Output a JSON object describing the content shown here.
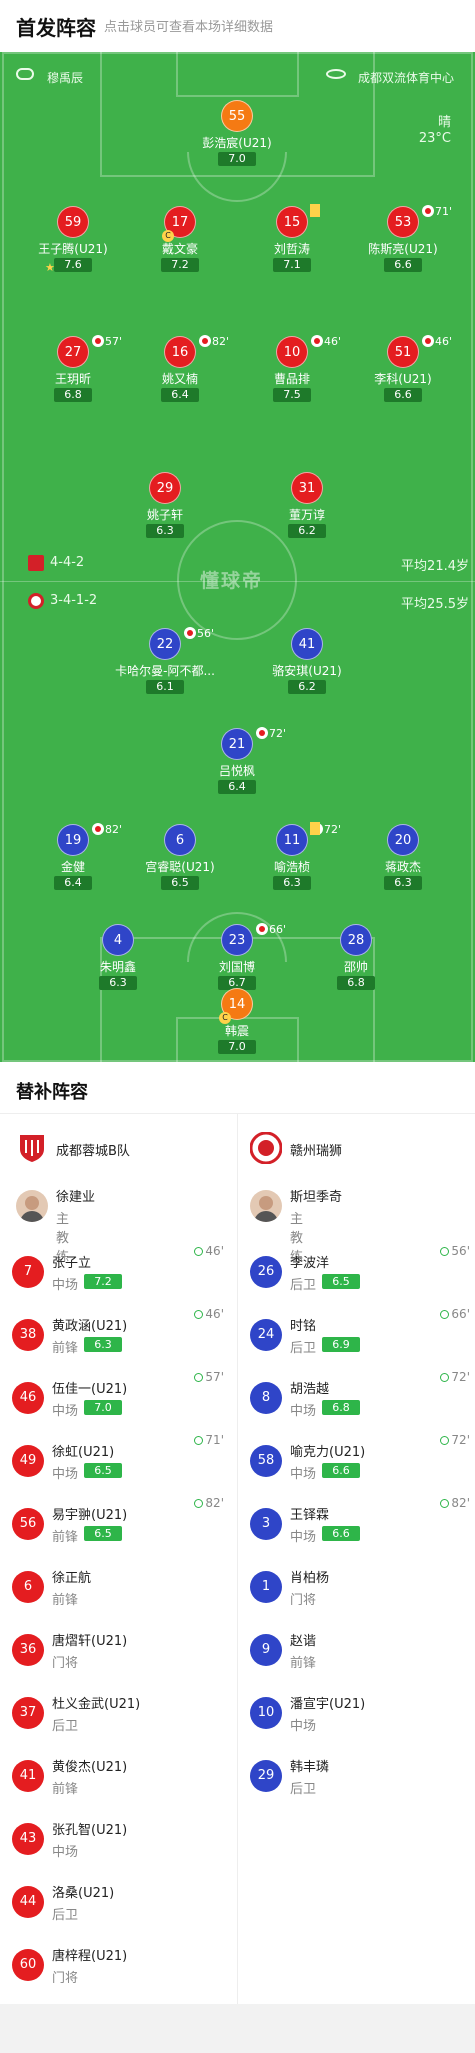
{
  "header": {
    "title": "首发阵容",
    "subtitle": "点击球员可查看本场详细数据"
  },
  "pitch": {
    "referee": "穆禹辰",
    "venue": "成都双流体育中心",
    "weather": "晴",
    "temperature": "23°C",
    "watermark": "懂球帝",
    "home": {
      "formation": "4-4-2",
      "avg_age": "平均21.4岁",
      "color": "#e41d20"
    },
    "away": {
      "formation": "3-4-1-2",
      "avg_age": "平均25.5岁",
      "color": "#2f45c8"
    }
  },
  "home_players": [
    {
      "num": "55",
      "name": "彭浩宸(U21)",
      "rating": "7.0",
      "color": "orange"
    },
    {
      "num": "59",
      "name": "王子腾(U21)",
      "rating": "7.6",
      "mvp": true
    },
    {
      "num": "17",
      "name": "戴文豪",
      "rating": "7.2",
      "captain": "C"
    },
    {
      "num": "15",
      "name": "刘哲涛",
      "rating": "7.1",
      "yellow": true
    },
    {
      "num": "53",
      "name": "陈斯亮(U21)",
      "rating": "6.6",
      "sub_minute": "71'"
    },
    {
      "num": "27",
      "name": "王玥昕",
      "rating": "6.8",
      "sub_minute": "57'"
    },
    {
      "num": "16",
      "name": "姚又楠",
      "rating": "6.4",
      "sub_minute": "82'"
    },
    {
      "num": "10",
      "name": "曹品排",
      "rating": "7.5",
      "sub_minute": "46'"
    },
    {
      "num": "51",
      "name": "李科(U21)",
      "rating": "6.6",
      "sub_minute": "46'"
    },
    {
      "num": "29",
      "name": "姚子轩",
      "rating": "6.3"
    },
    {
      "num": "31",
      "name": "董万谆",
      "rating": "6.2"
    }
  ],
  "away_players": [
    {
      "num": "22",
      "name": "卡哈尔曼-阿不都...",
      "rating": "6.1",
      "sub_minute": "56'"
    },
    {
      "num": "41",
      "name": "骆安琪(U21)",
      "rating": "6.2"
    },
    {
      "num": "21",
      "name": "吕悦枫",
      "rating": "6.4",
      "sub_minute": "72'"
    },
    {
      "num": "19",
      "name": "金健",
      "rating": "6.4",
      "sub_minute": "82'"
    },
    {
      "num": "6",
      "name": "宫睿聪(U21)",
      "rating": "6.5"
    },
    {
      "num": "11",
      "name": "喻浩桢",
      "rating": "6.3",
      "sub_minute": "72'",
      "yellow": true
    },
    {
      "num": "20",
      "name": "蒋政杰",
      "rating": "6.3"
    },
    {
      "num": "4",
      "name": "朱明鑫",
      "rating": "6.3"
    },
    {
      "num": "23",
      "name": "刘国博",
      "rating": "6.7",
      "sub_minute": "66'"
    },
    {
      "num": "28",
      "name": "邵帅",
      "rating": "6.8"
    },
    {
      "num": "14",
      "name": "韩震",
      "rating": "7.0",
      "color": "orange",
      "captain": "C"
    }
  ],
  "subs": {
    "title": "替补阵容",
    "role_coach": "主教练",
    "home": {
      "team": "成都蓉城B队",
      "coach": "徐建业",
      "players": [
        {
          "num": "7",
          "name": "张子立",
          "pos": "中场",
          "rating": "7.2",
          "in": "46'"
        },
        {
          "num": "38",
          "name": "黄政涵(U21)",
          "pos": "前锋",
          "rating": "6.3",
          "in": "46'"
        },
        {
          "num": "46",
          "name": "伍佳一(U21)",
          "pos": "中场",
          "rating": "7.0",
          "in": "57'"
        },
        {
          "num": "49",
          "name": "徐虹(U21)",
          "pos": "中场",
          "rating": "6.5",
          "in": "71'"
        },
        {
          "num": "56",
          "name": "易宇翀(U21)",
          "pos": "前锋",
          "rating": "6.5",
          "in": "82'"
        },
        {
          "num": "6",
          "name": "徐正航",
          "pos": "前锋"
        },
        {
          "num": "36",
          "name": "唐熠轩(U21)",
          "pos": "门将"
        },
        {
          "num": "37",
          "name": "杜义金武(U21)",
          "pos": "后卫"
        },
        {
          "num": "41",
          "name": "黄俊杰(U21)",
          "pos": "前锋"
        },
        {
          "num": "43",
          "name": "张孔智(U21)",
          "pos": "中场"
        },
        {
          "num": "44",
          "name": "洛桑(U21)",
          "pos": "后卫"
        },
        {
          "num": "60",
          "name": "唐梓程(U21)",
          "pos": "门将"
        }
      ]
    },
    "away": {
      "team": "赣州瑞狮",
      "coach": "斯坦季奇",
      "players": [
        {
          "num": "26",
          "name": "李波洋",
          "pos": "后卫",
          "rating": "6.5",
          "in": "56'"
        },
        {
          "num": "24",
          "name": "时铭",
          "pos": "后卫",
          "rating": "6.9",
          "in": "66'"
        },
        {
          "num": "8",
          "name": "胡浩越",
          "pos": "中场",
          "rating": "6.8",
          "in": "72'"
        },
        {
          "num": "58",
          "name": "喻克力(U21)",
          "pos": "中场",
          "rating": "6.6",
          "in": "72'"
        },
        {
          "num": "3",
          "name": "王铎霖",
          "pos": "中场",
          "rating": "6.6",
          "in": "82'"
        },
        {
          "num": "1",
          "name": "肖柏杨",
          "pos": "门将"
        },
        {
          "num": "9",
          "name": "赵谐",
          "pos": "前锋"
        },
        {
          "num": "10",
          "name": "潘宣宇(U21)",
          "pos": "中场"
        },
        {
          "num": "29",
          "name": "韩丰璘",
          "pos": "后卫"
        }
      ]
    }
  }
}
